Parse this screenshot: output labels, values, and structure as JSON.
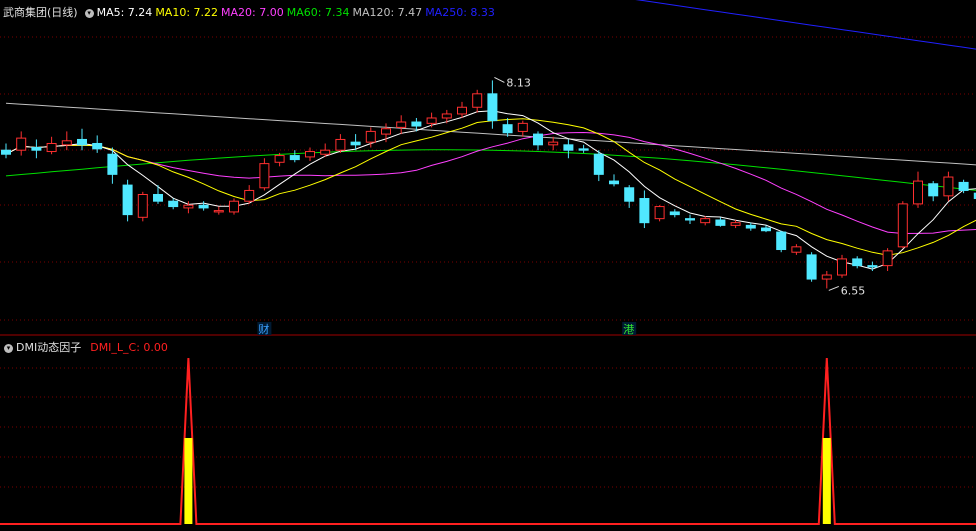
{
  "main_panel": {
    "title": "武商集团(日线)",
    "indicators": [
      {
        "label": "MA5: 7.24",
        "color": "#ffffff"
      },
      {
        "label": "MA10: 7.22",
        "color": "#ffff00"
      },
      {
        "label": "MA20: 7.00",
        "color": "#ff40ff"
      },
      {
        "label": "MA60: 7.34",
        "color": "#00e000"
      },
      {
        "label": "MA120: 7.47",
        "color": "#c0c0c0"
      },
      {
        "label": "MA250: 8.33",
        "color": "#2020ff"
      }
    ],
    "high_label": "8.13",
    "low_label": "6.55",
    "markers": [
      {
        "text": "财",
        "index": 17
      },
      {
        "text": "港",
        "index": 41
      }
    ]
  },
  "sub_panel": {
    "title": "DMI动态因子",
    "indicator": {
      "label": "DMI_L_C: 0.00",
      "color": "#ff2020"
    }
  },
  "colors": {
    "up": "#ff3030",
    "down": "#50e8ff",
    "bg": "#000000",
    "grid": "#7a0000"
  },
  "chart_data": [
    {
      "type": "candlestick",
      "title": "武商集团(日线)",
      "ylim": [
        6.3,
        8.55
      ],
      "ohlc": [
        [
          7.58,
          7.63,
          7.52,
          7.55
        ],
        [
          7.58,
          7.72,
          7.54,
          7.67
        ],
        [
          7.6,
          7.66,
          7.52,
          7.58
        ],
        [
          7.57,
          7.68,
          7.55,
          7.63
        ],
        [
          7.62,
          7.72,
          7.58,
          7.65
        ],
        [
          7.66,
          7.74,
          7.58,
          7.62
        ],
        [
          7.63,
          7.69,
          7.56,
          7.59
        ],
        [
          7.55,
          7.6,
          7.33,
          7.4
        ],
        [
          7.32,
          7.36,
          7.05,
          7.1
        ],
        [
          7.08,
          7.27,
          7.05,
          7.25
        ],
        [
          7.25,
          7.32,
          7.18,
          7.2
        ],
        [
          7.2,
          7.22,
          7.14,
          7.16
        ],
        [
          7.15,
          7.2,
          7.11,
          7.17
        ],
        [
          7.17,
          7.2,
          7.13,
          7.15
        ],
        [
          7.12,
          7.16,
          7.1,
          7.13
        ],
        [
          7.12,
          7.22,
          7.1,
          7.2
        ],
        [
          7.2,
          7.32,
          7.18,
          7.28
        ],
        [
          7.3,
          7.52,
          7.28,
          7.48
        ],
        [
          7.49,
          7.56,
          7.46,
          7.54
        ],
        [
          7.54,
          7.58,
          7.49,
          7.51
        ],
        [
          7.53,
          7.6,
          7.5,
          7.57
        ],
        [
          7.55,
          7.63,
          7.53,
          7.58
        ],
        [
          7.58,
          7.7,
          7.56,
          7.66
        ],
        [
          7.64,
          7.7,
          7.58,
          7.62
        ],
        [
          7.64,
          7.75,
          7.6,
          7.72
        ],
        [
          7.7,
          7.78,
          7.64,
          7.74
        ],
        [
          7.75,
          7.84,
          7.7,
          7.79
        ],
        [
          7.79,
          7.82,
          7.72,
          7.76
        ],
        [
          7.78,
          7.86,
          7.75,
          7.82
        ],
        [
          7.82,
          7.88,
          7.78,
          7.85
        ],
        [
          7.85,
          7.94,
          7.82,
          7.9
        ],
        [
          7.9,
          8.03,
          7.86,
          8.0
        ],
        [
          8.0,
          8.1,
          7.74,
          7.8
        ],
        [
          7.77,
          7.82,
          7.68,
          7.71
        ],
        [
          7.72,
          7.8,
          7.68,
          7.78
        ],
        [
          7.7,
          7.72,
          7.58,
          7.62
        ],
        [
          7.62,
          7.68,
          7.58,
          7.64
        ],
        [
          7.62,
          7.66,
          7.52,
          7.58
        ],
        [
          7.59,
          7.62,
          7.56,
          7.58
        ],
        [
          7.55,
          7.58,
          7.35,
          7.4
        ],
        [
          7.35,
          7.4,
          7.31,
          7.33
        ],
        [
          7.3,
          7.32,
          7.15,
          7.2
        ],
        [
          7.22,
          7.28,
          7.0,
          7.04
        ],
        [
          7.07,
          7.17,
          7.05,
          7.16
        ],
        [
          7.12,
          7.14,
          7.08,
          7.1
        ],
        [
          7.07,
          7.1,
          7.03,
          7.06
        ],
        [
          7.04,
          7.09,
          7.02,
          7.07
        ],
        [
          7.06,
          7.08,
          7.01,
          7.02
        ],
        [
          7.02,
          7.06,
          7.0,
          7.04
        ],
        [
          7.02,
          7.04,
          6.98,
          7.0
        ],
        [
          7.0,
          7.02,
          6.97,
          6.98
        ],
        [
          6.97,
          6.98,
          6.82,
          6.84
        ],
        [
          6.82,
          6.88,
          6.8,
          6.86
        ],
        [
          6.8,
          6.82,
          6.6,
          6.62
        ],
        [
          6.62,
          6.68,
          6.55,
          6.65
        ],
        [
          6.65,
          6.8,
          6.63,
          6.77
        ],
        [
          6.77,
          6.79,
          6.7,
          6.72
        ],
        [
          6.72,
          6.75,
          6.68,
          6.71
        ],
        [
          6.72,
          6.85,
          6.68,
          6.83
        ],
        [
          6.86,
          7.2,
          6.85,
          7.18
        ],
        [
          7.18,
          7.42,
          7.15,
          7.35
        ],
        [
          7.33,
          7.35,
          7.2,
          7.24
        ],
        [
          7.24,
          7.42,
          7.2,
          7.38
        ],
        [
          7.34,
          7.36,
          7.26,
          7.28
        ],
        [
          7.26,
          7.3,
          7.2,
          7.22
        ]
      ],
      "series": [
        {
          "name": "MA250",
          "color": "#2020ff",
          "values": [
            8.33
          ]
        },
        {
          "name": "MA120",
          "color": "#c0c0c0",
          "values": [
            7.47
          ]
        },
        {
          "name": "MA60",
          "color": "#00e000",
          "values": [
            7.34
          ]
        },
        {
          "name": "MA20",
          "color": "#ff40ff",
          "values": [
            7.0
          ]
        },
        {
          "name": "MA10",
          "color": "#ffff00",
          "values": [
            7.22
          ]
        },
        {
          "name": "MA5",
          "color": "#ffffff",
          "values": [
            7.24
          ]
        }
      ]
    },
    {
      "type": "line",
      "title": "DMI动态因子",
      "ylim": [
        0,
        1
      ],
      "series": [
        {
          "name": "DMI_L_C",
          "color": "#ff2020",
          "values": [
            0.0
          ]
        }
      ],
      "bars": [],
      "peaks_at_index": [
        12,
        54
      ]
    }
  ]
}
